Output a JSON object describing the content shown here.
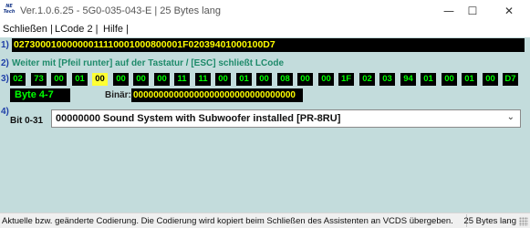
{
  "titlebar": {
    "logo_text": "NE\nTech",
    "title": "Ver.1.0.6.25 -   5G0-035-043-E | 25 Bytes lang",
    "minimize": "—",
    "maximize": "☐",
    "close": "✕"
  },
  "menu": {
    "items": [
      "Schließen |",
      "LCode 2 |",
      "Hilfe |"
    ]
  },
  "rows": {
    "r1": "1)",
    "r2": "2)",
    "r3": "3)",
    "r4": "4)"
  },
  "coding_hex": "02730001000000011110001000800001F02039401000100D7",
  "hint": "Weiter mit [Pfeil runter] auf der Tastatur / [ESC] schließt LCode",
  "bytes": [
    "02",
    "73",
    "00",
    "01",
    "00",
    "00",
    "00",
    "00",
    "11",
    "11",
    "00",
    "01",
    "00",
    "08",
    "00",
    "00",
    "1F",
    "02",
    "03",
    "94",
    "01",
    "00",
    "01",
    "00",
    "D7"
  ],
  "selected_byte_index": 4,
  "byte_range_label": "Byte 4-7",
  "binar": {
    "label": "Binär:",
    "value": "00000000000000000000000000000000"
  },
  "bit_selector": {
    "label": "Bit 0-31",
    "value": "00000000  Sound System with Subwoofer installed [PR-8RU]"
  },
  "status": {
    "left": "Aktuelle bzw. geänderte Codierung. Die Codierung wird kopiert beim Schließen des Assistenten an VCDS übergeben.",
    "right": "25 Bytes lang"
  },
  "colors": {
    "panel": "#c3dcdc",
    "field_bg": "#000000",
    "hex_text": "#ffff00",
    "byte_text": "#00ff00",
    "hint_text": "#1e8a6a",
    "row_number": "#1f3fa8"
  }
}
